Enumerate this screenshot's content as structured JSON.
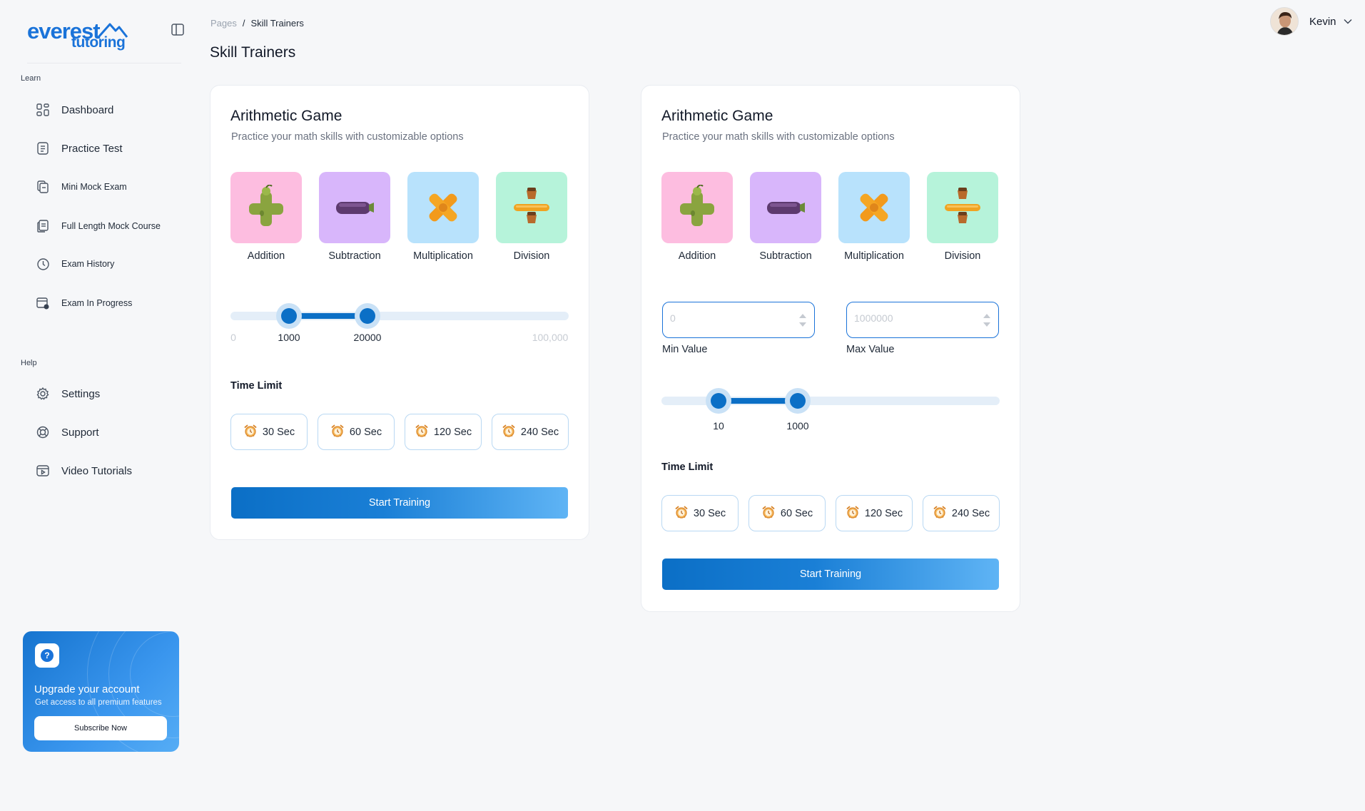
{
  "brand": {
    "line1": "everest",
    "line2": "tutoring",
    "color": "#1a73d9"
  },
  "sidebar": {
    "learn_label": "Learn",
    "help_label": "Help",
    "learn_items": [
      {
        "label": "Dashboard",
        "icon": "grid-icon"
      },
      {
        "label": "Practice Test",
        "icon": "document-icon"
      },
      {
        "label": "Mini Mock Exam",
        "icon": "copy-icon"
      },
      {
        "label": "Full Length Mock Course",
        "icon": "notes-icon"
      },
      {
        "label": "Exam History",
        "icon": "clock-icon"
      },
      {
        "label": "Exam In Progress",
        "icon": "calendar-progress-icon"
      }
    ],
    "help_items": [
      {
        "label": "Settings",
        "icon": "gear-icon"
      },
      {
        "label": "Support",
        "icon": "lifebuoy-icon"
      },
      {
        "label": "Video Tutorials",
        "icon": "video-icon"
      }
    ]
  },
  "upgrade": {
    "title": "Upgrade your account",
    "subtitle": "Get access to all premium features",
    "button": "Subscribe Now"
  },
  "header": {
    "breadcrumb": [
      "Pages",
      "Skill Trainers"
    ],
    "breadcrumb_sep": "/",
    "title": "Skill Trainers",
    "user_name": "Kevin"
  },
  "operations": [
    "Addition",
    "Subtraction",
    "Multiplication",
    "Division"
  ],
  "op_colors": [
    "#fdbde0",
    "#d8b6fb",
    "#b8e2fc",
    "#b6f3da"
  ],
  "cards": [
    {
      "title": "Arithmetic Game",
      "subtitle": "Practice your math skills with customizable options",
      "range": {
        "min": 0,
        "max": 100000,
        "low": 1000,
        "high": 20000,
        "min_label": "0",
        "max_label": "100,000",
        "low_label": "1000",
        "high_label": "20000"
      },
      "time_limit_label": "Time Limit",
      "time_options": [
        "30 Sec",
        "60 Sec",
        "120 Sec",
        "240 Sec"
      ],
      "start_label": "Start Training"
    },
    {
      "title": "Arithmetic Game",
      "subtitle": "Practice your math skills with customizable options",
      "min_value": {
        "placeholder": "0",
        "caption": "Min Value"
      },
      "max_value": {
        "placeholder": "1000000",
        "caption": "Max Value"
      },
      "range": {
        "low": 10,
        "high": 1000,
        "low_label": "10",
        "high_label": "1000"
      },
      "time_limit_label": "Time Limit",
      "time_options": [
        "30 Sec",
        "60 Sec",
        "120 Sec",
        "240 Sec"
      ],
      "start_label": "Start Training"
    }
  ]
}
